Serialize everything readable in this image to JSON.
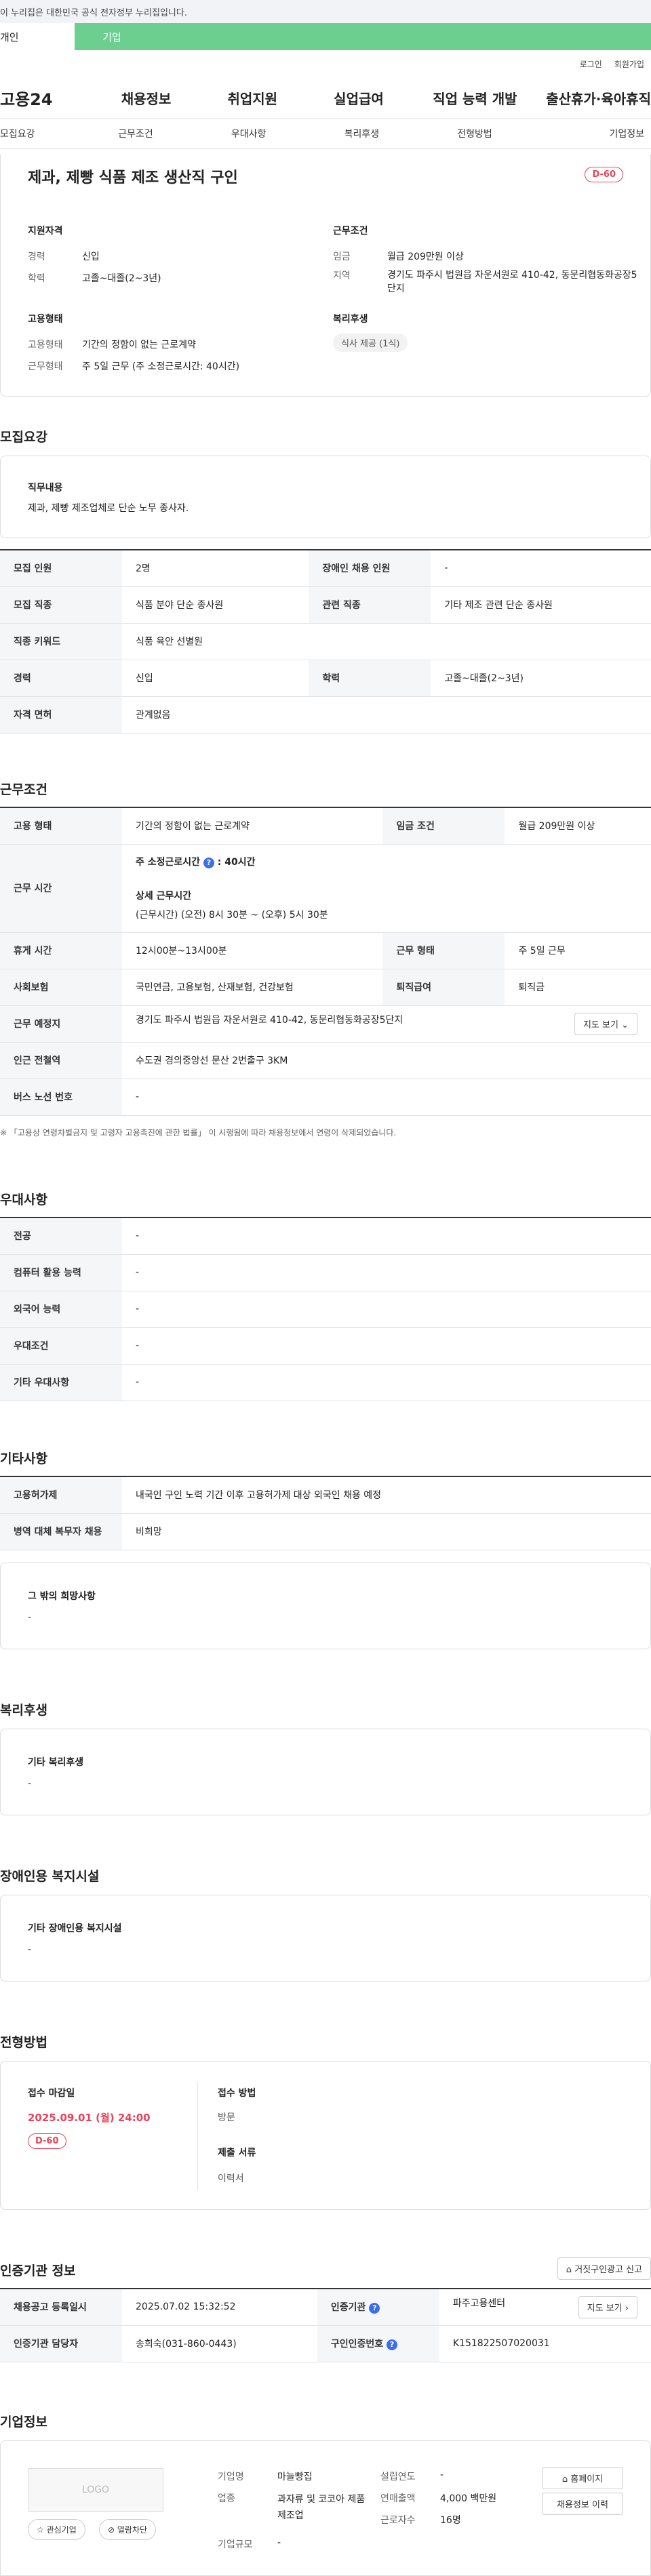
{
  "banner": "이 누리집은 대한민국 공식 전자정부 누리집입니다.",
  "top_tabs": [
    "개인",
    "기업"
  ],
  "util": [
    "로그인",
    "회원가입"
  ],
  "gnb": {
    "logo": "고용24",
    "menus": [
      "채용정보",
      "취업지원",
      "실업급여",
      "직업 능력 개발",
      "출산휴가·육아휴직"
    ]
  },
  "subnav": [
    "모집요강",
    "근무조건",
    "우대사항",
    "복리후생",
    "전형방법",
    "기업정보"
  ],
  "summary": {
    "title": "제과, 제빵 식품 제조 생산직 구인",
    "dday": "D-60",
    "qual_title": "지원자격",
    "qual": [
      {
        "k": "경력",
        "v": "신입"
      },
      {
        "k": "학력",
        "v": "고졸~대졸(2~3년)"
      }
    ],
    "cond_title": "근무조건",
    "cond": [
      {
        "k": "임금",
        "v": "월급 209만원 이상"
      },
      {
        "k": "지역",
        "v": "경기도 파주시 법원읍 자운서원로 410-42, 동문리협동화공장5단지"
      }
    ],
    "emp_title": "고용형태",
    "emp": [
      {
        "k": "고용형태",
        "v": "기간의 정함이 없는 근로계약"
      },
      {
        "k": "근무형태",
        "v": "주 5일 근무 (주 소정근로시간: 40시간)"
      }
    ],
    "welfare_title": "복리후생",
    "welfare_chip": "식사 제공 (1식)"
  },
  "recruit": {
    "title": "모집요강",
    "duty_title": "직무내용",
    "duty": "제과, 제빵 제조업체로 단순 노무 종사자.",
    "rows": [
      [
        "모집 인원",
        "2명",
        "장애인 채용 인원",
        "-"
      ],
      [
        "모집 직종",
        "식품 분야 단순 종사원",
        "관련 직종",
        "기타 제조 관련 단순 종사원"
      ],
      [
        "직종 키워드",
        "식품 육안 선별원",
        "",
        ""
      ],
      [
        "경력",
        "신입",
        "학력",
        "고졸~대졸(2~3년)"
      ],
      [
        "자격 면허",
        "관계없음",
        "",
        ""
      ]
    ]
  },
  "work": {
    "title": "근무조건",
    "type_label": "고용 형태",
    "type": "기간의 정함이 없는 근로계약",
    "wage_label": "임금 조건",
    "wage": "월급 209만원 이상",
    "hours_label": "근무 시간",
    "hours_weekly": "주 소정근로시간",
    "hours_weekly_val": ": 40시간",
    "hours_detail_title": "상세 근무시간",
    "hours_detail": "(근무시간) (오전) 8시 30분 ~ (오후) 5시 30분",
    "break_label": "휴게 시간",
    "break": "12시00분~13시00분",
    "form_label": "근무 형태",
    "form": "주 5일 근무",
    "ins_label": "사회보험",
    "ins": "국민연금, 고용보험, 산재보험, 건강보험",
    "ret_label": "퇴직급여",
    "ret": "퇴직금",
    "place_label": "근무 예정지",
    "place": "경기도 파주시 법원읍 자운서원로 410-42, 동문리협동화공장5단지",
    "map_btn": "지도 보기",
    "sub_label": "인근 전철역",
    "sub": "수도권 경의중앙선 문산 2번출구 3KM",
    "bus_label": "버스 노선 번호",
    "bus": "-",
    "note": "※ 「고용상 연령차별금지 및 고령자 고용촉진에 관한 법률」 이 시행됨에 따라 채용정보에서 연령이 삭제되었습니다."
  },
  "pref": {
    "title": "우대사항",
    "rows": [
      [
        "전공",
        "-"
      ],
      [
        "컴퓨터 활용 능력",
        "-"
      ],
      [
        "외국어 능력",
        "-"
      ],
      [
        "우대조건",
        "-"
      ],
      [
        "기타 우대사항",
        "-"
      ]
    ]
  },
  "etc": {
    "title": "기타사항",
    "rows": [
      [
        "고용허가제",
        "내국인 구인 노력 기간 이후 고용허가제 대상 외국인 채용 예정"
      ],
      [
        "병역 대체 복무자 채용",
        "비희망"
      ]
    ],
    "box_title": "그 밖의 희망사항",
    "box_val": "-"
  },
  "welfare": {
    "title": "복리후생",
    "box_title": "기타 복리후생",
    "box_val": "-"
  },
  "disab": {
    "title": "장애인용 복지시설",
    "box_title": "기타 장애인용 복지시설",
    "box_val": "-"
  },
  "select": {
    "title": "전형방법",
    "deadline_label": "접수 마감일",
    "deadline": "2025.09.01 (월) 24:00",
    "dday": "D-60",
    "method_label": "접수 방법",
    "method": "방문",
    "docs_label": "제출 서류",
    "docs": "이력서"
  },
  "cert": {
    "title": "인증기관 정보",
    "report_btn": "거짓구인광고 신고",
    "reg_label": "채용공고 등록일시",
    "reg": "2025.07.02 15:32:52",
    "org_label": "인증기관",
    "org": "파주고용센터",
    "map_btn": "지도 보기",
    "mgr_label": "인증기관 담당자",
    "mgr": "송희숙(031-860-0443)",
    "no_label": "구인인증번호",
    "no": "K151822507020031"
  },
  "company": {
    "title": "기업정보",
    "logo": "LOGO",
    "fav_btn": "관심기업",
    "block_btn": "열람차단",
    "name_label": "기업명",
    "name": "마늘빵집",
    "biz_label": "업종",
    "biz": "과자류 및 코코아 제품 제조업",
    "size_label": "기업규모",
    "size": "-",
    "est_label": "설립연도",
    "est": "-",
    "sales_label": "연매출액",
    "sales": "4,000 백만원",
    "emp_label": "근로자수",
    "emp": "16명",
    "home_btn": "홈페이지",
    "hist_btn": "채용정보 이력"
  }
}
